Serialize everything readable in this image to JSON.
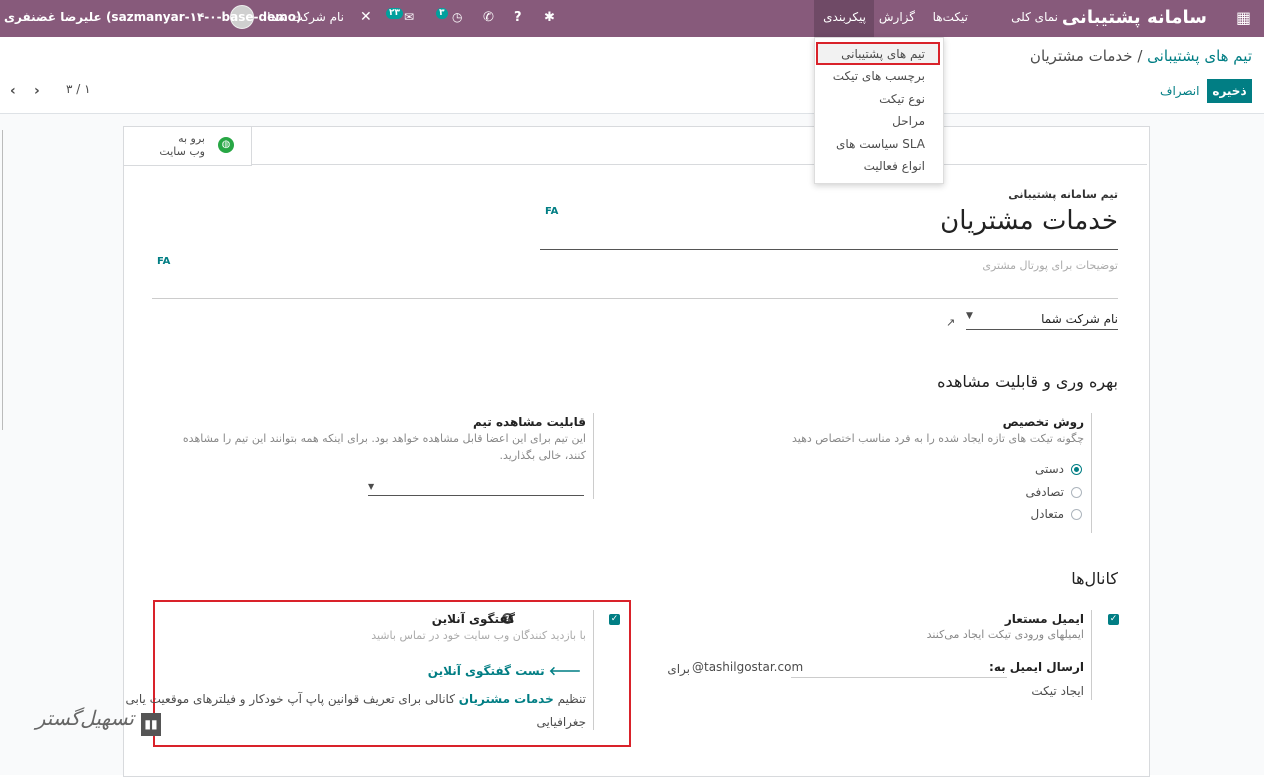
{
  "navbar": {
    "app_title": "سامانه پشتیبانی",
    "menus": [
      "نمای کلی",
      "تیکت‌ها",
      "گزارش",
      "پیکربندی"
    ],
    "company": "نام شرکت شما",
    "badge_activity": "۳",
    "badge_messages": "۲۳",
    "user": "علیرضا غضنفری (sazmanyar-۱۴-۰-base-demo)"
  },
  "dropdown": {
    "items": [
      "تیم های پشتیبانی",
      "برچسب های تیکت",
      "نوع تیکت",
      "مراحل",
      "سیاست های SLA",
      "انواع فعالیت"
    ]
  },
  "control": {
    "breadcrumb_parent": "تیم های پشتیبانی",
    "breadcrumb_sep": "/",
    "breadcrumb_current": "خدمات مشتریان",
    "save": "ذخیره",
    "discard": "انصراف",
    "pager": "۱ / ۳"
  },
  "form": {
    "website_button_line1": "برو به",
    "website_button_line2": "وب سایت",
    "team_label": "تیم سامانه پشتیبانی",
    "team_name": "خدمات مشتریان",
    "lang_tag": "FA",
    "description_placeholder": "توضیحات برای پورتال مشتری",
    "company": "نام شرکت شما",
    "section_productivity": "بهره وری و قابلیت مشاهده",
    "assign_title": "روش تخصیص",
    "assign_desc": "چگونه تیکت های تازه ایجاد شده را به فرد مناسب اختصاص دهید",
    "assign_options": [
      "دستی",
      "تصادفی",
      "متعادل"
    ],
    "visibility_title": "قابلیت مشاهده تیم",
    "visibility_desc_1": "این تیم برای این اعضا قابل مشاهده خواهد بود. برای اینکه همه بتوانند این تیم را مشاهده",
    "visibility_desc_2": "کنند، خالی بگذارید.",
    "section_channels": "کانال‌ها",
    "email_title": "ایمیل مستعار",
    "email_desc": "ایمیلهای ورودی تیکت ایجاد می‌کنند",
    "email_send_label": "ارسال ایمیل به:",
    "email_domain": "@tashilgostar.com",
    "email_for": "برای",
    "email_create": "ایجاد تیکت",
    "chat_title": "گفتگوی آنلاین",
    "chat_desc": "با بازدید کنندگان وب سایت خود در تماس باشید",
    "chat_test": "تست گفتگوی آنلاین",
    "chat_config_prefix": "تنظیم",
    "chat_config_link": "خدمات مشتریان",
    "chat_config_suffix": "کانالی برای تعریف قوانین پاپ آپ خودکار و فیلترهای موقعیت یابی",
    "chat_config_line2": "جغرافیایی"
  },
  "watermark": "تسهیل‌گستر"
}
